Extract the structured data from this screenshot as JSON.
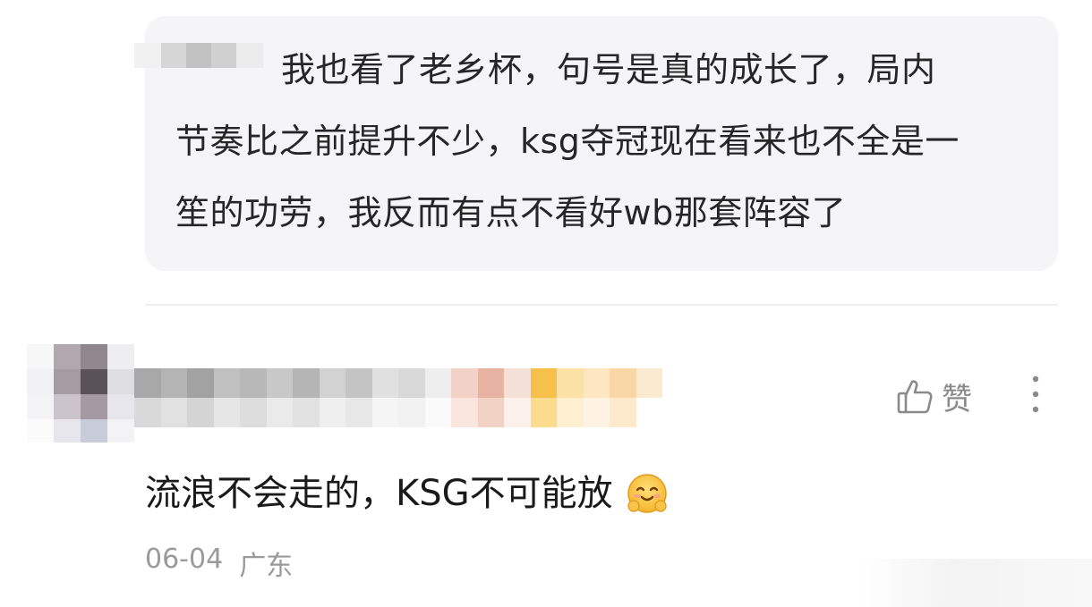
{
  "quote": {
    "text_line1": "我也看了老乡杯，句号是真的成长了，局内",
    "text_line2": "节奏比之前提升不少，ksg夺冠现在看来也不全是一",
    "text_line3": "笙的功劳，我反而有点不看好wb那套阵容了"
  },
  "comment": {
    "text": "流浪不会走的，KSG不可能放",
    "emoji": "smiling-hug-emoji",
    "date": "06-04",
    "location": "广东"
  },
  "actions": {
    "like_label": "赞",
    "like_icon": "thumbs-up-icon",
    "more_icon": "vertical-ellipsis-icon"
  },
  "colors": {
    "card_bg": "#f5f5f7",
    "meta_gray": "#9a9a9a",
    "icon_gray": "#8a8a8a"
  }
}
